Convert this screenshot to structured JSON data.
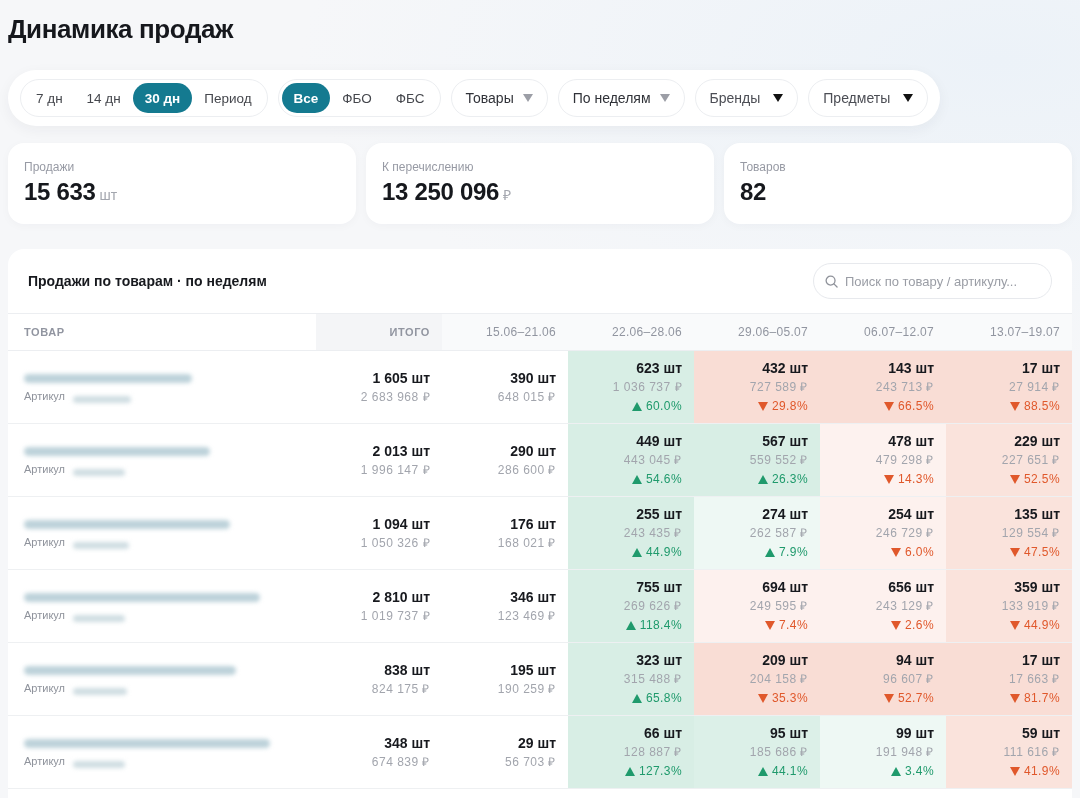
{
  "title": "Динамика продаж",
  "period_tabs": [
    {
      "label": "7 дн",
      "selected": false
    },
    {
      "label": "14 дн",
      "selected": false
    },
    {
      "label": "30 дн",
      "selected": true
    },
    {
      "label": "Период",
      "selected": false
    }
  ],
  "fulfillment_tabs": [
    {
      "label": "Все",
      "selected": true
    },
    {
      "label": "ФБО",
      "selected": false
    },
    {
      "label": "ФБС",
      "selected": false
    }
  ],
  "dropdowns": [
    {
      "label": "Товары",
      "kind": "filter"
    },
    {
      "label": "По неделям",
      "kind": "filter"
    },
    {
      "label": "Бренды",
      "kind": "select"
    },
    {
      "label": "Предметы",
      "kind": "select"
    }
  ],
  "stats": [
    {
      "label": "Продажи",
      "value": "15 633",
      "unit": "шт"
    },
    {
      "label": "К перечислению",
      "value": "13 250 096",
      "unit": "₽"
    },
    {
      "label": "Товаров",
      "value": "82"
    }
  ],
  "table": {
    "title": "Продажи по товарам · по неделям",
    "search": {
      "placeholder": "Поиск по товару / артикулу..."
    },
    "columns": [
      "ТОВАР",
      "ИТОГО",
      "15.06–21.06",
      "22.06–28.06",
      "29.06–05.07",
      "06.07–12.07",
      "13.07–19.07"
    ],
    "rows": [
      {
        "product": {
          "name_blurred": true,
          "article_label": "Артикул",
          "article_blurred": true
        },
        "total": {
          "units": "1 605 шт",
          "revenue": "2 683 968 ₽"
        },
        "weeks": [
          {
            "kind": "base",
            "units": "390 шт",
            "revenue": "648 015 ₽"
          },
          {
            "kind": "delta",
            "units": "623 шт",
            "revenue": "1 036 737 ₽",
            "growth": true,
            "change": "60.0%",
            "color": "#d8eee5"
          },
          {
            "kind": "delta",
            "units": "432 шт",
            "revenue": "727 589 ₽",
            "growth": false,
            "change": "29.8%",
            "color": "#f9ddd5"
          },
          {
            "kind": "delta",
            "units": "143 шт",
            "revenue": "243 713 ₽",
            "growth": false,
            "change": "66.5%",
            "color": "#f9ddd5"
          },
          {
            "kind": "delta",
            "units": "17 шт",
            "revenue": "27 914 ₽",
            "growth": false,
            "change": "88.5%",
            "color": "#f9ddd5"
          }
        ]
      },
      {
        "product": {
          "name_blurred": true,
          "article_label": "Артикул",
          "article_blurred": true
        },
        "total": {
          "units": "2 013 шт",
          "revenue": "1 996 147 ₽"
        },
        "weeks": [
          {
            "kind": "base",
            "units": "290 шт",
            "revenue": "286 600 ₽"
          },
          {
            "kind": "delta",
            "units": "449 шт",
            "revenue": "443 045 ₽",
            "growth": true,
            "change": "54.6%",
            "color": "#d8eee5"
          },
          {
            "kind": "delta",
            "units": "567 шт",
            "revenue": "559 552 ₽",
            "growth": true,
            "change": "26.3%",
            "color": "#d8eee5"
          },
          {
            "kind": "delta",
            "units": "478 шт",
            "revenue": "479 298 ₽",
            "growth": false,
            "change": "14.3%",
            "color": "#fdf2ef"
          },
          {
            "kind": "delta",
            "units": "229 шт",
            "revenue": "227 651 ₽",
            "growth": false,
            "change": "52.5%",
            "color": "#fae3dc"
          }
        ]
      },
      {
        "product": {
          "name_blurred": true,
          "article_label": "Артикул",
          "article_blurred": true
        },
        "total": {
          "units": "1 094 шт",
          "revenue": "1 050 326 ₽"
        },
        "weeks": [
          {
            "kind": "base",
            "units": "176 шт",
            "revenue": "168 021 ₽"
          },
          {
            "kind": "delta",
            "units": "255 шт",
            "revenue": "243 435 ₽",
            "growth": true,
            "change": "44.9%",
            "color": "#d8eee5"
          },
          {
            "kind": "delta",
            "units": "274 шт",
            "revenue": "262 587 ₽",
            "growth": true,
            "change": "7.9%",
            "color": "#eef8f4"
          },
          {
            "kind": "delta",
            "units": "254 шт",
            "revenue": "246 729 ₽",
            "growth": false,
            "change": "6.0%",
            "color": "#fdf1ee"
          },
          {
            "kind": "delta",
            "units": "135 шт",
            "revenue": "129 554 ₽",
            "growth": false,
            "change": "47.5%",
            "color": "#fae3dc"
          }
        ]
      },
      {
        "product": {
          "name_blurred": true,
          "article_label": "Артикул",
          "article_blurred": true
        },
        "total": {
          "units": "2 810 шт",
          "revenue": "1 019 737 ₽"
        },
        "weeks": [
          {
            "kind": "base",
            "units": "346 шт",
            "revenue": "123 469 ₽"
          },
          {
            "kind": "delta",
            "units": "755 шт",
            "revenue": "269 626 ₽",
            "growth": true,
            "change": "118.4%",
            "color": "#d8eee5"
          },
          {
            "kind": "delta",
            "units": "694 шт",
            "revenue": "249 595 ₽",
            "growth": false,
            "change": "7.4%",
            "color": "#fdf1ee"
          },
          {
            "kind": "delta",
            "units": "656 шт",
            "revenue": "243 129 ₽",
            "growth": false,
            "change": "2.6%",
            "color": "#fdf1ee"
          },
          {
            "kind": "delta",
            "units": "359 шт",
            "revenue": "133 919 ₽",
            "growth": false,
            "change": "44.9%",
            "color": "#fae3dc"
          }
        ]
      },
      {
        "product": {
          "name_blurred": true,
          "article_label": "Артикул",
          "article_blurred": true
        },
        "total": {
          "units": "838 шт",
          "revenue": "824 175 ₽"
        },
        "weeks": [
          {
            "kind": "base",
            "units": "195 шт",
            "revenue": "190 259 ₽"
          },
          {
            "kind": "delta",
            "units": "323 шт",
            "revenue": "315 488 ₽",
            "growth": true,
            "change": "65.8%",
            "color": "#d8eee5"
          },
          {
            "kind": "delta",
            "units": "209 шт",
            "revenue": "204 158 ₽",
            "growth": false,
            "change": "35.3%",
            "color": "#f9ddd5"
          },
          {
            "kind": "delta",
            "units": "94 шт",
            "revenue": "96 607 ₽",
            "growth": false,
            "change": "52.7%",
            "color": "#f9ddd5"
          },
          {
            "kind": "delta",
            "units": "17 шт",
            "revenue": "17 663 ₽",
            "growth": false,
            "change": "81.7%",
            "color": "#f9ddd5"
          }
        ]
      },
      {
        "product": {
          "name_blurred": true,
          "article_label": "Артикул",
          "article_blurred": true
        },
        "total": {
          "units": "348 шт",
          "revenue": "674 839 ₽"
        },
        "weeks": [
          {
            "kind": "base",
            "units": "29 шт",
            "revenue": "56 703 ₽"
          },
          {
            "kind": "delta",
            "units": "66 шт",
            "revenue": "128 887 ₽",
            "growth": true,
            "change": "127.3%",
            "color": "#d8eee5"
          },
          {
            "kind": "delta",
            "units": "95 шт",
            "revenue": "185 686 ₽",
            "growth": true,
            "change": "44.1%",
            "color": "#dcf0e8"
          },
          {
            "kind": "delta",
            "units": "99 шт",
            "revenue": "191 948 ₽",
            "growth": true,
            "change": "3.4%",
            "color": "#eef8f4"
          },
          {
            "kind": "delta",
            "units": "59 шт",
            "revenue": "111 616 ₽",
            "growth": false,
            "change": "41.9%",
            "color": "#fae3dc"
          }
        ]
      }
    ]
  }
}
